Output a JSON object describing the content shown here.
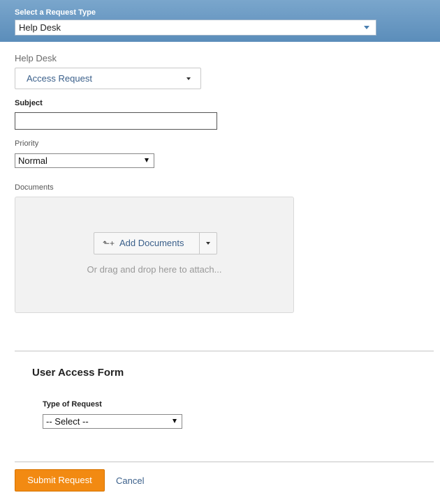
{
  "request_type": {
    "label": "Select a Request Type",
    "value": "Help Desk"
  },
  "category": {
    "label": "Help Desk",
    "value": "Access Request"
  },
  "subject": {
    "label": "Subject",
    "value": ""
  },
  "priority": {
    "label": "Priority",
    "value": "Normal"
  },
  "documents": {
    "label": "Documents",
    "add_button": "Add Documents",
    "drop_hint": "Or drag and drop here to attach..."
  },
  "user_access_form": {
    "title": "User Access Form",
    "type_label": "Type of Request",
    "type_value": "-- Select --"
  },
  "actions": {
    "submit": "Submit Request",
    "cancel": "Cancel"
  },
  "colors": {
    "header_bar": "#6b9bc6",
    "submit": "#f28a12",
    "link": "#3a5f8a"
  }
}
